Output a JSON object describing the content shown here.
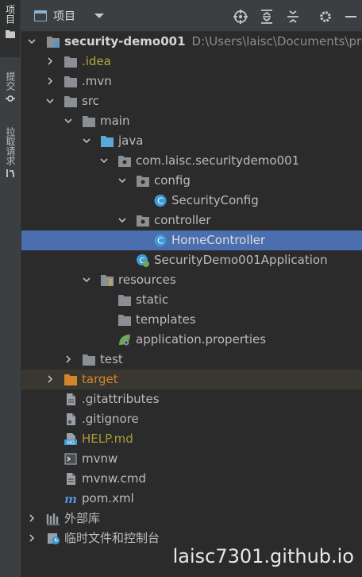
{
  "left_strip": {
    "tabs": [
      {
        "label": "项目",
        "icon": "folder-icon"
      },
      {
        "label": "提交",
        "icon": "commit-icon"
      },
      {
        "label": "拉取请求",
        "icon": "pull-request-icon"
      }
    ]
  },
  "toolbar": {
    "view_label": "项目",
    "icons": [
      "locate-icon",
      "expand-all-icon",
      "collapse-all-icon",
      "settings-icon",
      "minimize-icon"
    ]
  },
  "tree": {
    "root": {
      "name": "security-demo001",
      "path": "D:\\Users\\laisc\\Documents\\progr"
    },
    "nodes": {
      "idea": ".idea",
      "mvn": ".mvn",
      "src": "src",
      "main": "main",
      "java": "java",
      "package": "com.laisc.securitydemo001",
      "config": "config",
      "security_config": "SecurityConfig",
      "controller": "controller",
      "home_controller": "HomeController",
      "app_class": "SecurityDemo001Application",
      "resources": "resources",
      "static": "static",
      "templates": "templates",
      "app_properties": "application.properties",
      "test": "test",
      "target": "target",
      "gitattributes": ".gitattributes",
      "gitignore": ".gitignore",
      "help": "HELP.md",
      "mvnw": "mvnw",
      "mvnw_cmd": "mvnw.cmd",
      "pom": "pom.xml",
      "external_libs": "外部库",
      "scratches": "临时文件和控制台"
    }
  },
  "watermark": "laisc7301.github.io",
  "colors": {
    "background": "#2b2b2b",
    "selection": "#4b6eaf",
    "folder": "#8b8f93",
    "source_folder": "#59a8d6",
    "excluded_folder": "#d2862c",
    "class_icon": "#3e9bd6"
  }
}
